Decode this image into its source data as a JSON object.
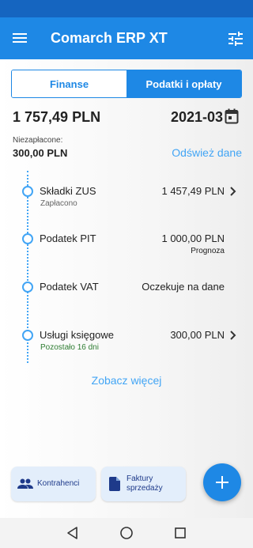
{
  "app": {
    "title": "Comarch ERP XT",
    "colors": {
      "primary": "#1e88e5",
      "status_bar": "#1565c0",
      "link": "#42a5f5",
      "positive": "#2e7d32"
    }
  },
  "tabs": [
    {
      "label": "Finanse",
      "active": false
    },
    {
      "label": "Podatki i opłaty",
      "active": true
    }
  ],
  "summary": {
    "total": "1 757,49 PLN",
    "period": "2021-03",
    "unpaid_label": "Niezapłacone:",
    "unpaid_value": "300,00 PLN",
    "refresh_label": "Odśwież dane"
  },
  "items": [
    {
      "name": "Składki ZUS",
      "amount": "1 457,49 PLN",
      "status": "Zapłacono",
      "status_color": "#666666",
      "has_chevron": true
    },
    {
      "name": "Podatek PIT",
      "amount": "1 000,00 PLN",
      "note": "Prognoza",
      "has_chevron": false
    },
    {
      "name": "Podatek VAT",
      "amount": "Oczekuje na dane",
      "has_chevron": false
    },
    {
      "name": "Usługi księgowe",
      "amount": "300,00 PLN",
      "status": "Pozostało 16 dni",
      "status_color": "#2e7d32",
      "has_chevron": true
    }
  ],
  "see_more_label": "Zobacz więcej",
  "bottom_actions": {
    "contractors_label": "Kontrahenci",
    "invoices_label_line1": "Faktury",
    "invoices_label_line2": "sprzedaży"
  },
  "icons": {
    "menu": "hamburger-icon",
    "filter": "tune-icon",
    "calendar": "calendar-icon",
    "contractors": "people-icon",
    "invoices": "document-icon",
    "add": "plus-icon",
    "back": "triangle-back-icon",
    "home": "circle-home-icon",
    "recents": "square-recents-icon"
  }
}
